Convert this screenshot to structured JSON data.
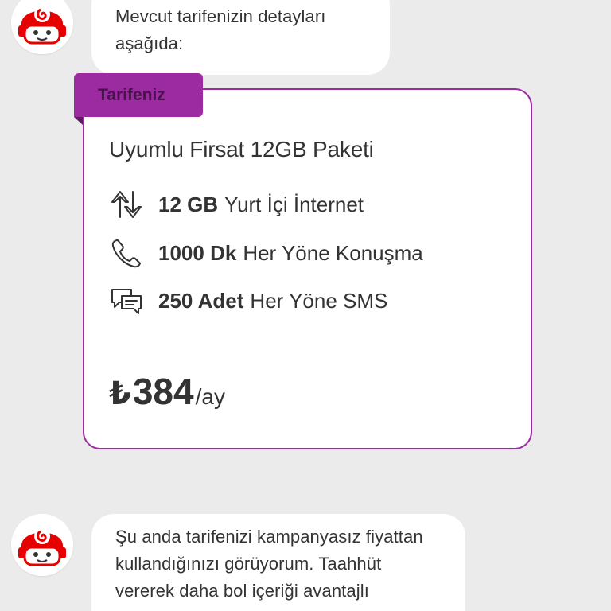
{
  "colors": {
    "background": "#ebebeb",
    "bubble": "#ffffff",
    "accent": "#9c2aa0",
    "brand_red": "#e60000",
    "text": "#333333"
  },
  "messages": [
    {
      "sender_icon": "vodafone-assistant-avatar",
      "text": "Mevcut tarifenizin detayları aşağıda:"
    },
    {
      "sender_icon": "vodafone-assistant-avatar",
      "lines": [
        "Şu anda tarifenizi kampanyasız fiyattan",
        "kullandığınızı görüyorum. Taahhüt",
        "vererek daha bol içeriği avantajlı"
      ]
    }
  ],
  "tariff_card": {
    "tag": "Tarifeniz",
    "title": "Uyumlu Firsat 12GB Paketi",
    "features": [
      {
        "icon": "data-transfer-icon",
        "amount": "12 GB",
        "label": "Yurt İçi İnternet"
      },
      {
        "icon": "phone-icon",
        "amount": "1000 Dk",
        "label": "Her Yöne Konuşma"
      },
      {
        "icon": "sms-icon",
        "amount": "250 Adet",
        "label": "Her Yöne SMS"
      }
    ],
    "price": {
      "currency": "₺",
      "amount": "384",
      "period": "/ay"
    }
  }
}
